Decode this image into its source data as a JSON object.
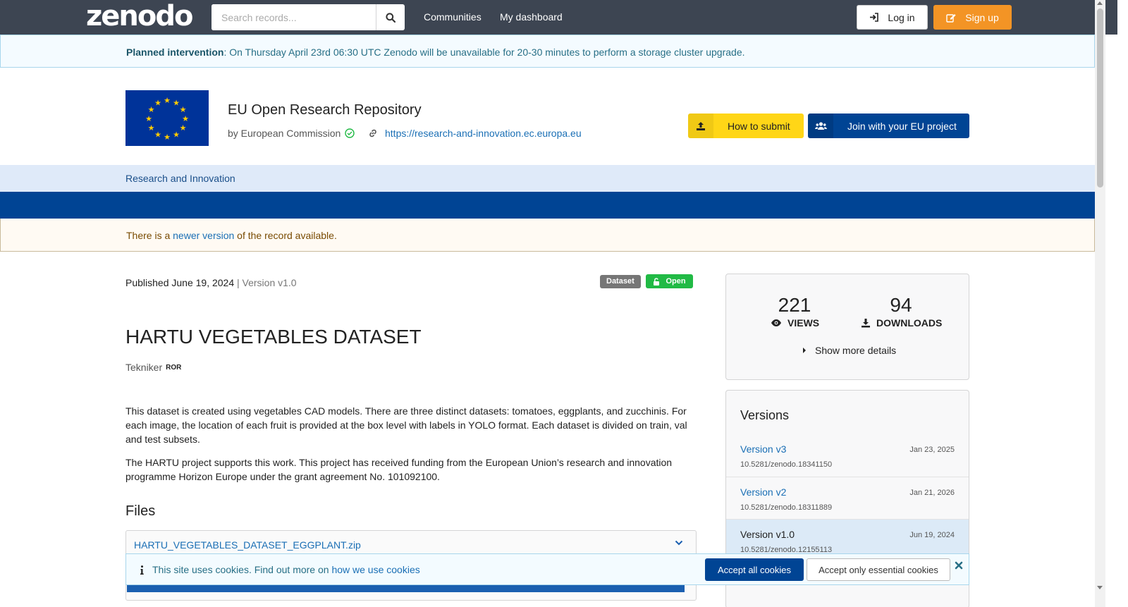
{
  "header": {
    "logo": "zenodo",
    "search_placeholder": "Search records...",
    "nav": [
      "Communities",
      "My dashboard"
    ],
    "login_label": "Log in",
    "signup_label": "Sign up"
  },
  "notice": {
    "bold": "Planned intervention",
    "text": ": On Thursday April 23rd 06:30 UTC Zenodo will be unavailable for 20-30 minutes to perform a storage cluster upgrade."
  },
  "community": {
    "title": "EU Open Research Repository",
    "by": "by European Commission",
    "url": "https://research-and-innovation.ec.europa.eu",
    "how_to_submit": "How to submit",
    "join_project": "Join with your EU project",
    "subnav_item": "Research and Innovation"
  },
  "new_version": {
    "prefix": "There is a ",
    "link": "newer version",
    "suffix": " of the record available."
  },
  "record": {
    "published": "Published June 19, 2024",
    "version": " | Version v1.0",
    "resource_type": "Dataset",
    "access": "Open",
    "title": "HARTU VEGETABLES DATASET",
    "creator": "Tekniker",
    "creator_badge": "ROR",
    "description_1": "This dataset is created using vegetables CAD models. There are three distinct datasets: tomatoes, eggplants, and zucchinis. For each image, the location of each fruit is provided at the box level with labels in YOLO format. Each dataset is divided on train, val and test subsets.",
    "description_2": "The HARTU project supports this work. This project has received funding from the European Union’s research and innovation programme Horizon Europe under the grant agreement No. 101092100.",
    "files_heading": "Files",
    "file_name": "HARTU_VEGETABLES_DATASET_EGGPLANT.zip"
  },
  "stats": {
    "views": "221",
    "views_label": "VIEWS",
    "downloads": "94",
    "downloads_label": "DOWNLOADS",
    "more_details": "Show more details"
  },
  "versions": {
    "heading": "Versions",
    "items": [
      {
        "name": "Version v3",
        "date": "Jan 23, 2025",
        "doi": "10.5281/zenodo.18341150"
      },
      {
        "name": "Version v2",
        "date": "Jan 21, 2026",
        "doi": "10.5281/zenodo.18311889"
      },
      {
        "name": "Version v1.0",
        "date": "Jun 19, 2024",
        "doi": "10.5281/zenodo.12155113"
      }
    ]
  },
  "cookies": {
    "text": "This site uses cookies. Find out more on ",
    "link": "how we use cookies",
    "accept_all": "Accept all cookies",
    "accept_essential": "Accept only essential cookies"
  },
  "colors": {
    "navbar": "#3d4552",
    "signup": "#f39425",
    "eu_blue": "#004494",
    "eu_yellow": "#ffd617",
    "open_green": "#21ba45"
  }
}
